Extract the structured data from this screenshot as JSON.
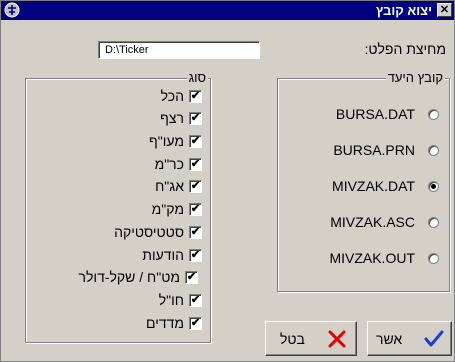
{
  "window": {
    "title": "יצוא קובץ",
    "close_glyph": "✕",
    "app_icon": "app-emblem-icon"
  },
  "destination": {
    "label": "מחיצת הפלט:",
    "value": "D:\\Ticker"
  },
  "file_type": {
    "legend": "קובץ היעד",
    "options": [
      {
        "label": "BURSA.DAT",
        "selected": false
      },
      {
        "label": "BURSA.PRN",
        "selected": false
      },
      {
        "label": "MIVZAK.DAT",
        "selected": true
      },
      {
        "label": "MIVZAK.ASC",
        "selected": false
      },
      {
        "label": "MIVZAK.OUT",
        "selected": false
      }
    ]
  },
  "types": {
    "legend": "סוג",
    "items": [
      {
        "label": "הכל",
        "checked": true
      },
      {
        "label": "רצף",
        "checked": true
      },
      {
        "label": "מעו\"ף",
        "checked": true
      },
      {
        "label": "כר\"מ",
        "checked": true
      },
      {
        "label": "אג\"ח",
        "checked": true
      },
      {
        "label": "מק\"מ",
        "checked": true
      },
      {
        "label": "סטטיסטיקה",
        "checked": true
      },
      {
        "label": "הודעות",
        "checked": true
      },
      {
        "label": "מט\"ח / שקל-דולר",
        "checked": true
      },
      {
        "label": "חו\"ל",
        "checked": true
      },
      {
        "label": "מדדים",
        "checked": true
      }
    ]
  },
  "buttons": {
    "ok_label": "אשר",
    "cancel_label": "בטל",
    "ok_icon": "check-icon",
    "cancel_icon": "x-icon"
  },
  "colors": {
    "titlebar": "#000080",
    "ok_check": "#1a3fd6",
    "cancel_x": "#e00000"
  }
}
